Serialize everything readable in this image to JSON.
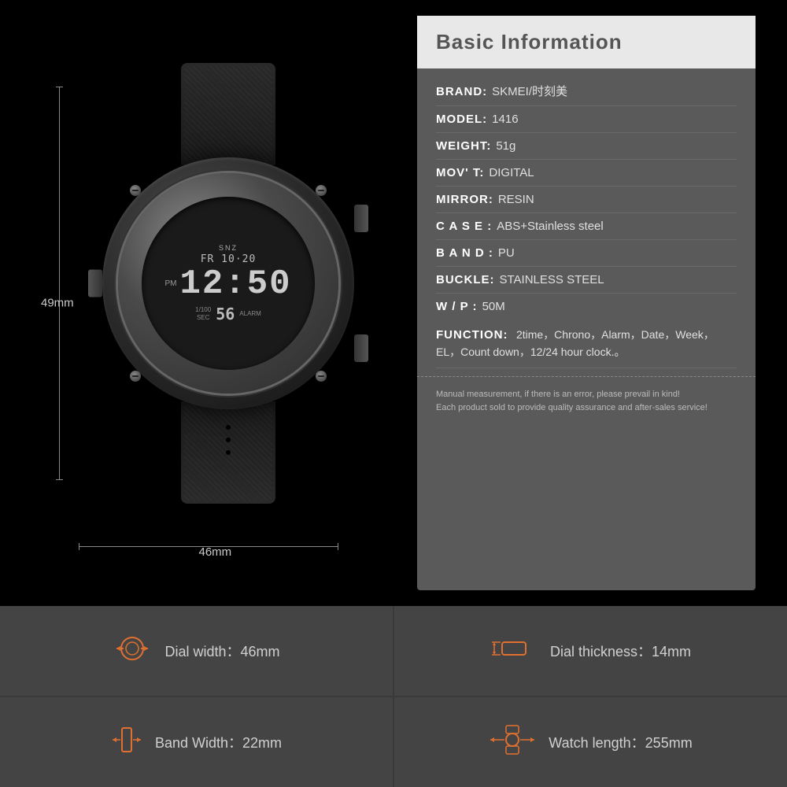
{
  "info": {
    "title": "Basic Information",
    "rows": [
      {
        "label": "BRAND:",
        "value": "SKMEI/时刻美"
      },
      {
        "label": "MODEL:",
        "value": "1416"
      },
      {
        "label": "WEIGHT:",
        "value": "51g"
      },
      {
        "label": "MOV' T:",
        "value": "DIGITAL"
      },
      {
        "label": "MIRROR:",
        "value": "RESIN"
      },
      {
        "label": "C A S E :",
        "value": "ABS+Stainless steel"
      },
      {
        "label": "B A N D :",
        "value": "PU"
      },
      {
        "label": "BUCKLE:",
        "value": "STAINLESS STEEL"
      },
      {
        "label": "W / P :",
        "value": "50M"
      }
    ],
    "function_label": "FUNCTION:",
    "function_value": "2time，Chrono，Alarm，Date，Week，EL，Count down，12/24 hour clock.。",
    "disclaimer_1": "Manual measurement, if there is an error, please prevail in kind!",
    "disclaimer_2": "Each product sold to provide quality assurance and after-sales service!"
  },
  "dimensions": {
    "height_label": "49mm",
    "width_label": "46mm"
  },
  "watch_display": {
    "snz": "SNZ",
    "date": "FR 10·20",
    "pm": "PM",
    "time": "12:50",
    "sec_label": "1/100\nSEC",
    "small_num": "56",
    "alarm_label": "ALARM"
  },
  "specs": [
    {
      "icon": "⊙→",
      "label": "Dial width：46mm"
    },
    {
      "icon": "⬟→",
      "label": "Dial thickness：14mm"
    },
    {
      "icon": "▮→",
      "label": "Band Width：22mm"
    },
    {
      "icon": "⊙→",
      "label": "Watch length：255mm"
    }
  ]
}
